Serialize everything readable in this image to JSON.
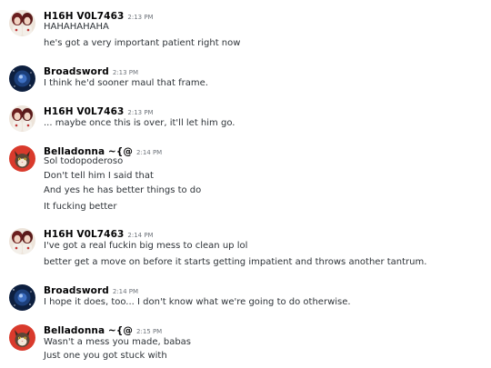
{
  "icons": {
    "avatar_h16h": "avatar-h16h-icon",
    "avatar_broadsword": "avatar-broadsword-icon",
    "avatar_belladonna": "avatar-belladonna-icon"
  },
  "colors": {
    "username": "#060607",
    "timestamp": "#6f747b",
    "message_text": "#2e3338",
    "background": "#ffffff"
  },
  "messages": [
    {
      "username": "H16H V0L7463",
      "timestamp": "2:13 PM",
      "lines": [
        "HAHAHAHAHA",
        "he's got a very important patient right now"
      ]
    },
    {
      "username": "Broadsword",
      "timestamp": "2:13 PM",
      "lines": [
        "I think he'd sooner maul that frame."
      ]
    },
    {
      "username": "H16H V0L7463",
      "timestamp": "2:13 PM",
      "lines": [
        "... maybe once this is over, it'll let him go."
      ]
    },
    {
      "username": "Belladonna ~{@",
      "timestamp": "2:14 PM",
      "lines": [
        "Sol todopoderoso",
        "Don't tell him I said that",
        "And yes he has better things to do",
        "It fucking better"
      ]
    },
    {
      "username": "H16H V0L7463",
      "timestamp": "2:14 PM",
      "lines": [
        "I've got a real fuckin big mess to clean up lol",
        "better get a move on before it starts getting impatient and throws another tantrum."
      ]
    },
    {
      "username": "Broadsword",
      "timestamp": "2:14 PM",
      "lines": [
        "I hope it does, too... I don't know what we're going to do otherwise."
      ]
    },
    {
      "username": "Belladonna ~{@",
      "timestamp": "2:15 PM",
      "lines": [
        "Wasn't a mess you made, babas",
        "Just one you got stuck with"
      ]
    }
  ]
}
